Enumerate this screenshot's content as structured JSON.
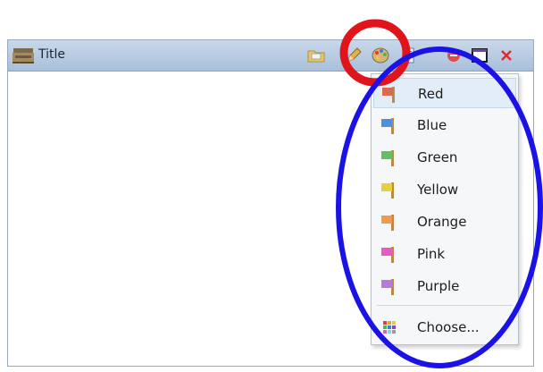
{
  "window": {
    "title": "Title"
  },
  "toolbar": {
    "icons": [
      "open-folder-icon",
      "pencil-icon",
      "palette-icon",
      "page-icon",
      "minimize-icon",
      "maximize-icon",
      "close-icon"
    ]
  },
  "color_menu": {
    "items": [
      {
        "label": "Red",
        "color": "#d9694f",
        "highlighted": true
      },
      {
        "label": "Blue",
        "color": "#4f8fe0"
      },
      {
        "label": "Green",
        "color": "#5fc25a"
      },
      {
        "label": "Yellow",
        "color": "#e8cf3e"
      },
      {
        "label": "Orange",
        "color": "#f09a4b"
      },
      {
        "label": "Pink",
        "color": "#e85bc3"
      },
      {
        "label": "Purple",
        "color": "#b779e0"
      }
    ],
    "choose_label": "Choose..."
  },
  "annotations": {
    "red_circle_color": "#e0141b",
    "blue_ellipse_color": "#1a12e6"
  }
}
